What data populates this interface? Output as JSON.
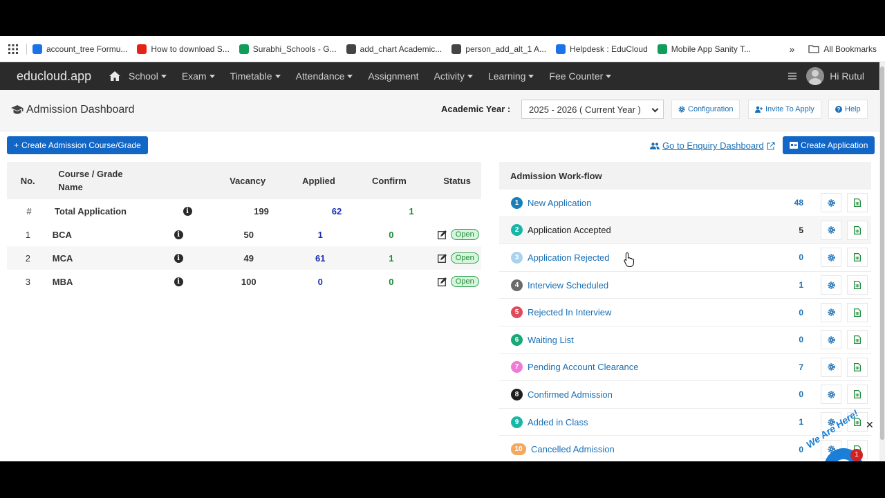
{
  "bookmarks": [
    {
      "label": "account_tree Formu...",
      "color": "#1a73e8"
    },
    {
      "label": "How to download S...",
      "color": "#e62117"
    },
    {
      "label": "Surabhi_Schools - G...",
      "color": "#0f9d58"
    },
    {
      "label": "add_chart Academic...",
      "color": "#444444"
    },
    {
      "label": "person_add_alt_1 A...",
      "color": "#444444"
    },
    {
      "label": "Helpdesk : EduCloud",
      "color": "#1a73e8"
    },
    {
      "label": "Mobile App Sanity T...",
      "color": "#0f9d58"
    }
  ],
  "bookmarks_more": "»",
  "all_bookmarks": "All Bookmarks",
  "nav": {
    "brand": "educloud.app",
    "items": [
      "School",
      "Exam",
      "Timetable",
      "Attendance",
      "Assignment",
      "Activity",
      "Learning",
      "Fee Counter"
    ],
    "dropdown_items": [
      true,
      true,
      true,
      true,
      false,
      true,
      true,
      true
    ],
    "greeting": "Hi Rutul"
  },
  "header": {
    "title": "Admission Dashboard",
    "academic_year_label": "Academic Year :",
    "academic_year_value": "2025 - 2026 ( Current Year )",
    "configuration": "Configuration",
    "invite": "Invite To Apply",
    "help": "Help"
  },
  "actions": {
    "create_course": "Create Admission Course/Grade",
    "enquiry": "Go to Enquiry Dashboard",
    "create_application": "Create Application"
  },
  "course_table": {
    "headers": {
      "no": "No.",
      "name": "Course / Grade Name",
      "vacancy": "Vacancy",
      "applied": "Applied",
      "confirm": "Confirm",
      "status": "Status"
    },
    "total": {
      "no": "#",
      "name": "Total Application",
      "vacancy": "199",
      "applied": "62",
      "confirm": "1"
    },
    "rows": [
      {
        "no": "1",
        "name": "BCA",
        "vacancy": "50",
        "applied": "1",
        "confirm": "0",
        "status": "Open"
      },
      {
        "no": "2",
        "name": "MCA",
        "vacancy": "49",
        "applied": "61",
        "confirm": "1",
        "status": "Open"
      },
      {
        "no": "3",
        "name": "MBA",
        "vacancy": "100",
        "applied": "0",
        "confirm": "0",
        "status": "Open"
      }
    ]
  },
  "workflow": {
    "title": "Admission Work-flow",
    "steps": [
      {
        "num": "1",
        "label": "New Application",
        "count": "48",
        "color": "#1a7fb8"
      },
      {
        "num": "2",
        "label": "Application Accepted",
        "count": "5",
        "color": "#19b6a5"
      },
      {
        "num": "3",
        "label": "Application Rejected",
        "count": "0",
        "color": "#a9d2ee"
      },
      {
        "num": "4",
        "label": "Interview Scheduled",
        "count": "1",
        "color": "#6b6b6b"
      },
      {
        "num": "5",
        "label": "Rejected In Interview",
        "count": "0",
        "color": "#e04a5a"
      },
      {
        "num": "6",
        "label": "Waiting List",
        "count": "0",
        "color": "#1aa87a"
      },
      {
        "num": "7",
        "label": "Pending Account Clearance",
        "count": "7",
        "color": "#f07ad8"
      },
      {
        "num": "8",
        "label": "Confirmed Admission",
        "count": "0",
        "color": "#1f1f1f"
      },
      {
        "num": "9",
        "label": "Added in Class",
        "count": "1",
        "color": "#19b6a5"
      },
      {
        "num": "10",
        "label": "Cancelled Admission",
        "count": "0",
        "color": "#f4a860"
      }
    ]
  },
  "chat": {
    "badge": "1",
    "banner": "We Are Here!"
  }
}
